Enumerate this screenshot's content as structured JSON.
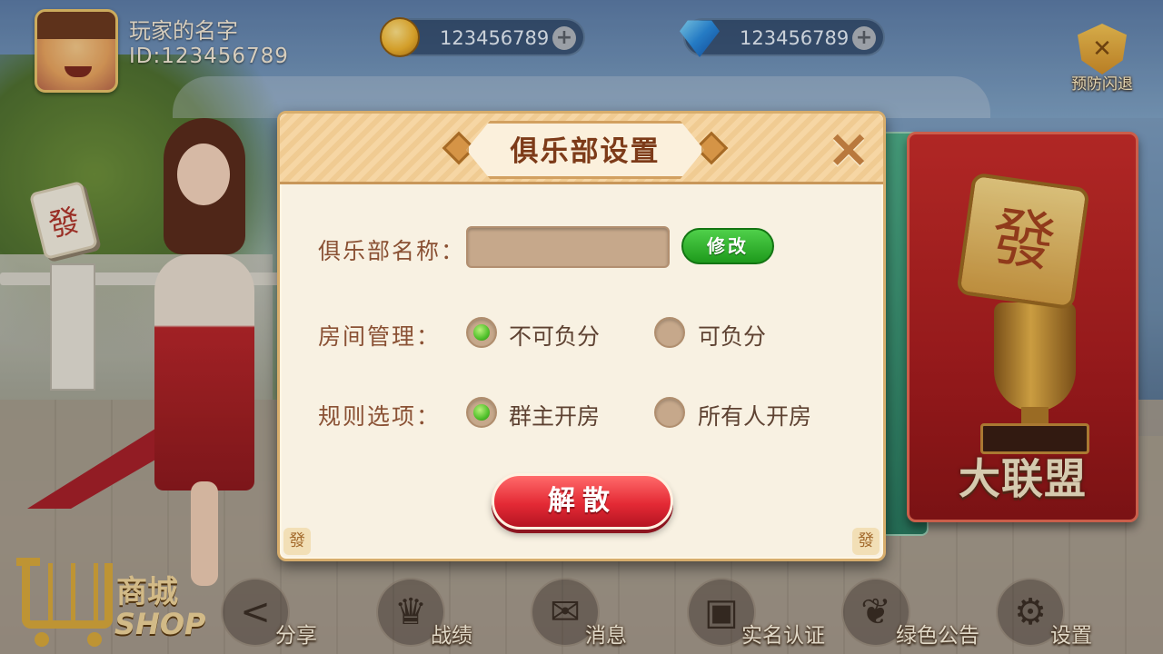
{
  "player": {
    "name": "玩家的名字",
    "id": "ID:123456789"
  },
  "currencies": [
    {
      "icon": "coin-icon",
      "value": "123456789"
    },
    {
      "icon": "diamond-icon",
      "value": "123456789"
    }
  ],
  "anti_cheat": {
    "label": "预防闪退"
  },
  "dialog": {
    "title": "俱乐部设置",
    "club_name_label": "俱乐部名称：",
    "club_name_value": "",
    "modify_button": "修改",
    "room_management": {
      "label": "房间管理：",
      "options": [
        {
          "label": "不可负分",
          "selected": true
        },
        {
          "label": "可负分",
          "selected": false
        }
      ]
    },
    "rule_options": {
      "label": "规则选项：",
      "options": [
        {
          "label": "群主开房",
          "selected": true
        },
        {
          "label": "所有人开房",
          "selected": false
        }
      ]
    },
    "dissolve_button": "解散",
    "corner_glyph": "發"
  },
  "alliance": {
    "title": "大联盟",
    "tile_glyph": "發"
  },
  "background": {
    "tile_glyph": "發"
  },
  "shop": {
    "label_cn": "商城",
    "label_en": "SHOP"
  },
  "bottom_nav": [
    {
      "label": "分享",
      "icon": "share-icon"
    },
    {
      "label": "战绩",
      "icon": "trophy-icon"
    },
    {
      "label": "消息",
      "icon": "mail-icon"
    },
    {
      "label": "实名认证",
      "icon": "id-card-icon"
    },
    {
      "label": "绿色公告",
      "icon": "leaf-icon"
    },
    {
      "label": "设置",
      "icon": "gear-icon"
    }
  ],
  "colors": {
    "dialog_bg": "#f8f1e2",
    "title_text": "#7d3b19",
    "dissolve_red": "#e42a35",
    "modify_green": "#1e9a1c",
    "radio_selected": "#4fc02a",
    "alliance_red": "#c92d2a"
  }
}
